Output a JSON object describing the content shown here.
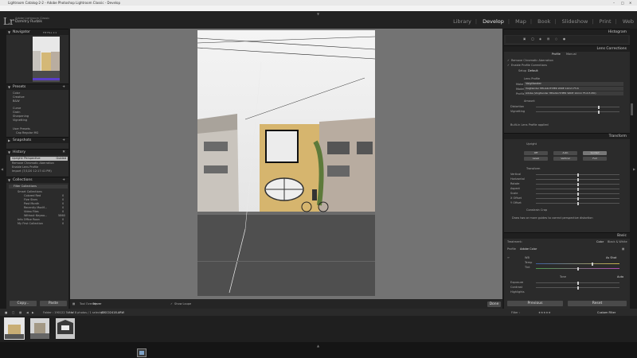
{
  "window": {
    "title": "Lightroom Catalog-2-2 - Adobe Photoshop Lightroom Classic - Develop"
  },
  "menu": [
    "File",
    "Edit",
    "Develop",
    "Photo",
    "Settings",
    "Tools",
    "View",
    "Window",
    "Help",
    "Scripts"
  ],
  "identity": {
    "logo": "Lr",
    "subtitle": "Adobe Lightroom Classic",
    "user": "Dzmitry Rudzik"
  },
  "modules": [
    "Library",
    "Develop",
    "Map",
    "Book",
    "Slideshow",
    "Print",
    "Web"
  ],
  "left": {
    "navigator": {
      "title": "Navigator",
      "zoom": [
        "FIT",
        "FILL",
        "1:1"
      ]
    },
    "presets": {
      "title": "Presets",
      "items": [
        "Color",
        "Creative",
        "B&W",
        "Curve",
        "Grain",
        "Sharpening",
        "Vignetting",
        "User Presets",
        "Cap Regular MG"
      ]
    },
    "snapshots": {
      "title": "Snapshots"
    },
    "history": {
      "title": "History",
      "items": [
        {
          "label": "Upright: Perspective",
          "value": "Guided"
        },
        {
          "label": "Remove Chromatic Aberration",
          "value": ""
        },
        {
          "label": "Enable Lens Profile",
          "value": ""
        },
        {
          "label": "Import (7/1/20 12:17:41 PM)",
          "value": ""
        }
      ]
    },
    "collections": {
      "title": "Collections",
      "items": [
        {
          "label": "Filter Collections",
          "count": ""
        },
        {
          "label": "Smart Collections",
          "count": ""
        },
        {
          "label": "Colored Red",
          "count": "0"
        },
        {
          "label": "Five Stars",
          "count": "0"
        },
        {
          "label": "Past Month",
          "count": "0"
        },
        {
          "label": "Recently Modif...",
          "count": "0"
        },
        {
          "label": "Video Files",
          "count": "0"
        },
        {
          "label": "Without Keywo...",
          "count": "5860"
        },
        {
          "label": "Info Office Roon",
          "count": "0"
        },
        {
          "label": "My First Collection",
          "count": "0"
        }
      ]
    },
    "copy": "Copy...",
    "paste": "Paste"
  },
  "right": {
    "histogram": {
      "title": "Histogram"
    },
    "lens": {
      "title": "Lens Corrections",
      "tabs": [
        "Profile",
        "Manual"
      ],
      "checks": [
        "Remove Chromatic Aberration",
        "Enable Profile Corrections"
      ],
      "setup_label": "Setup",
      "setup_value": "Default",
      "section": "Lens Profile",
      "rows": [
        {
          "k": "Make",
          "v": "Voigtlander"
        },
        {
          "k": "Model",
          "v": "Voigtlander HELIAR-HYPER WIDE 10mm F5.6"
        },
        {
          "k": "Profile",
          "v": "Adobe (Voigtlander HELIAR-HYPER WIDE 10mm F5.6 E-MO)"
        }
      ],
      "amount": "Amount",
      "distortion": "Distortion",
      "vignetting": "Vignetting",
      "note": "Built-in Lens Profile applied"
    },
    "transform": {
      "title": "Transform",
      "upright": "Upright",
      "upright_buttons": [
        "Off",
        "Auto",
        "Guided",
        "Level",
        "Vertical",
        "Full"
      ],
      "section": "Transform",
      "sliders": [
        "Vertical",
        "Horizontal",
        "Rotate",
        "Aspect",
        "Scale",
        "X Offset",
        "Y Offset"
      ],
      "constrain": "Constrain Crop",
      "hint": "Draw two or more guides to correct perspective distortion"
    },
    "basic": {
      "title": "Basic",
      "tabs": [
        "Treatment:",
        "Color",
        "Black & White"
      ],
      "profile_label": "Profile",
      "profile_value": "Adobe Color",
      "wb_label": "WB",
      "wb_value": "As Shot",
      "temp": "Temp",
      "tint": "Tint",
      "tone": "Tone",
      "auto": "Auto",
      "exposure": "Exposure",
      "contrast": "Contrast",
      "highlights": "Highlights"
    },
    "previous": "Previous",
    "reset": "Reset"
  },
  "toolbar": {
    "guides": "Tool Overlay",
    "grid": "Never",
    "show_loupe": "Show Loupe",
    "done": "Done"
  },
  "filmstrip": {
    "source": "Folder : 190122 Tonfo",
    "count": "3 of 8 photos / 1 selected",
    "filename": "/DSC02418.ARW",
    "filter_label": "Filter :",
    "filter_value": "Custom Filter"
  }
}
